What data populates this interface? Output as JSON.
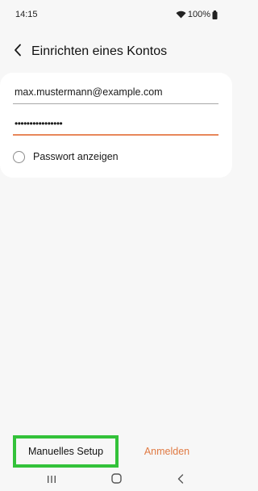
{
  "status_bar": {
    "time": "14:15",
    "battery": "100%",
    "icons": [
      "wifi-icon",
      "battery-icon"
    ]
  },
  "header": {
    "back_icon": "chevron-left-icon",
    "title": "Einrichten eines Kontos"
  },
  "form": {
    "email_value": "max.mustermann@example.com",
    "password_value": "••••••••••••••••",
    "show_password_label": "Passwort anzeigen",
    "show_password_checked": false
  },
  "actions": {
    "manual_setup_label": "Manuelles Setup",
    "login_label": "Anmelden"
  },
  "colors": {
    "accent": "#e07a43",
    "highlight": "#33c23a",
    "background": "#f7f7f7"
  },
  "nav_bar": {
    "icons": [
      "recent-apps-icon",
      "home-icon",
      "back-icon"
    ]
  }
}
